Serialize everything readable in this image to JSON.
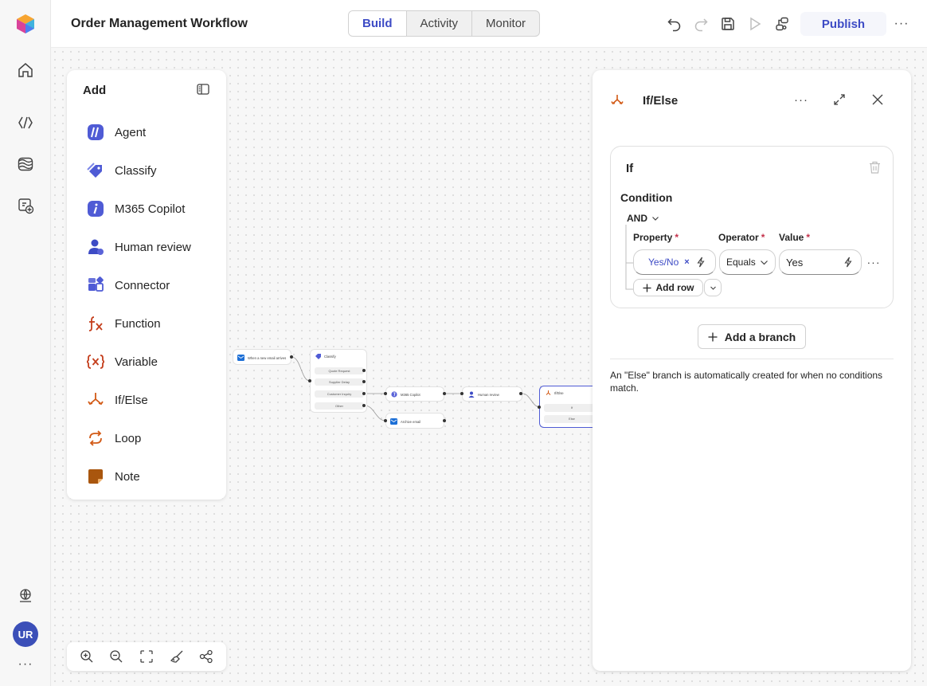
{
  "rail": {
    "avatar_initials": "UR",
    "more_label": "···"
  },
  "header": {
    "title": "Order Management Workflow",
    "tabs": [
      {
        "label": "Build",
        "active": true
      },
      {
        "label": "Activity",
        "active": false
      },
      {
        "label": "Monitor",
        "active": false
      }
    ],
    "publish_label": "Publish",
    "more_label": "···"
  },
  "add_panel": {
    "title": "Add",
    "items": [
      {
        "label": "Agent",
        "icon": "agent-icon"
      },
      {
        "label": "Classify",
        "icon": "classify-icon"
      },
      {
        "label": "M365 Copilot",
        "icon": "copilot-icon"
      },
      {
        "label": "Human review",
        "icon": "human-review-icon"
      },
      {
        "label": "Connector",
        "icon": "connector-icon"
      },
      {
        "label": "Function",
        "icon": "function-icon"
      },
      {
        "label": "Variable",
        "icon": "variable-icon"
      },
      {
        "label": "If/Else",
        "icon": "if-else-icon"
      },
      {
        "label": "Loop",
        "icon": "loop-icon"
      },
      {
        "label": "Note",
        "icon": "note-icon"
      }
    ]
  },
  "flow": {
    "trigger": "When a new email arrives",
    "classify": {
      "title": "Classify",
      "categories": [
        "Quote Request",
        "Supplier Delay",
        "Customer Inquiry",
        "Other"
      ]
    },
    "copilot": "M365 Copilot",
    "human_review": "Human review",
    "archive": "Archive email",
    "ifelse": {
      "title": "If/Else",
      "branches": [
        "If",
        "Else"
      ]
    }
  },
  "properties": {
    "title": "If/Else",
    "more_label": "···",
    "if_label": "If",
    "condition_label": "Condition",
    "logic": "AND",
    "columns": {
      "property": "Property",
      "operator": "Operator",
      "value": "Value"
    },
    "required_mark": "*",
    "row": {
      "property": "Yes/No",
      "remove": "×",
      "operator": "Equals",
      "value": "Yes"
    },
    "row_more": "···",
    "add_row_label": "Add row",
    "add_branch_label": "Add a branch",
    "note": "An \"Else\" branch is automatically created for when no conditions match."
  },
  "colors": {
    "accent": "#3d4bc5",
    "orange": "#d25a16",
    "required": "#c4314b",
    "avatar": "#3b4fb8"
  }
}
